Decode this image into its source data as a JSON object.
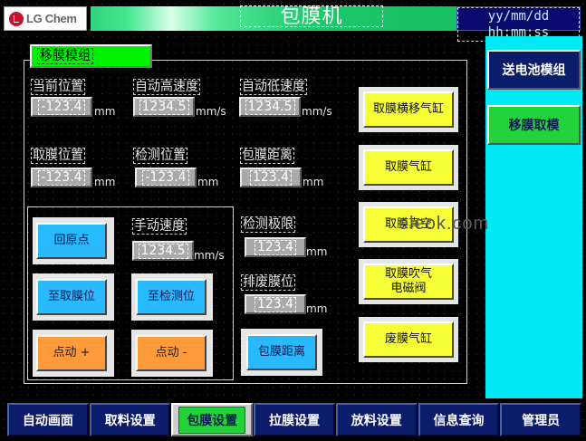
{
  "header": {
    "logo_text": "LG Chem",
    "title": "包膜机",
    "clock": "yy/mm/dd hh:mm:ss"
  },
  "side": {
    "btn1": "送电池模组",
    "btn2": "移膜取模"
  },
  "module": {
    "title": "移膜模组"
  },
  "fields": {
    "current_pos": {
      "label": "当前位置",
      "value": "-123.4",
      "unit": "mm"
    },
    "auto_high_speed": {
      "label": "自动高速度",
      "value": "1234.5",
      "unit": "mm/s"
    },
    "auto_low_speed": {
      "label": "自动低速度",
      "value": "1234.5",
      "unit": "mm/s"
    },
    "take_film_pos": {
      "label": "取膜位置",
      "value": "-123.4",
      "unit": "mm"
    },
    "detect_pos": {
      "label": "检测位置",
      "value": "-123.4",
      "unit": "mm"
    },
    "wrap_distance": {
      "label": "包膜距离",
      "value": "123.4",
      "unit": "mm"
    },
    "manual_speed": {
      "label": "手动速度",
      "value": "1234.5",
      "unit": "mm/s"
    },
    "detect_limit": {
      "label": "检测极限",
      "value": "123.4",
      "unit": "mm"
    },
    "waste_film_pos": {
      "label": "排废膜位",
      "value": "123.4",
      "unit": "mm"
    }
  },
  "buttons": {
    "home": "回原点",
    "to_take_film": "至取膜位",
    "to_detect": "至检测位",
    "jog_plus": "点动 +",
    "jog_minus": "点动 -",
    "wrap_distance": "包膜距离",
    "cyl_film_transfer": "取膜横移气缸",
    "cyl_take_film": "取膜气缸",
    "take_film_vacuum": "取膜真空",
    "take_film_blow_l1": "取膜吹气",
    "take_film_blow_l2": "电磁阀",
    "waste_film_cyl": "废膜气缸"
  },
  "watermark": "eleok.com",
  "nav": {
    "items": [
      "自动画面",
      "取料设置",
      "包膜设置",
      "拉膜设置",
      "放料设置",
      "信息查询",
      "管理员"
    ],
    "active": 2
  },
  "colors": {
    "accent_green": "#22d23a",
    "cyan_panel": "#00e9f5",
    "button_blue": "#29b9ff",
    "button_yellow": "#f6ff35",
    "button_orange": "#ff9b3a",
    "nav_blue": "#0b1c6b"
  }
}
